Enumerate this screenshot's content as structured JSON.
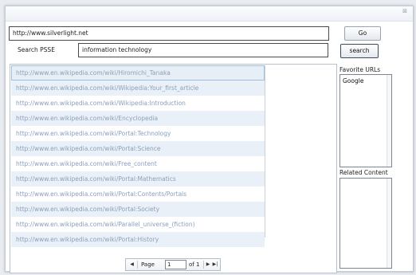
{
  "window": {
    "close_symbol": "⊠"
  },
  "address": {
    "value": "http://www.silverlight.net",
    "go_label": "Go"
  },
  "search": {
    "label": "Search PSSE",
    "value": "information technology",
    "button_label": "search"
  },
  "results": [
    "http://www.en.wikipedia.com/wiki/Hiromichi_Tanaka",
    "http://www.en.wikipedia.com/wiki/Wikipedia:Your_first_article",
    "http://www.en.wikipedia.com/wiki/Wikipedia:Introduction",
    "http://www.en.wikipedia.com/wiki/Encyclopedia",
    "http://www.en.wikipedia.com/wiki/Portal:Technology",
    "http://www.en.wikipedia.com/wiki/Portal:Science",
    "http://www.en.wikipedia.com/wiki/Free_content",
    "http://www.en.wikipedia.com/wiki/Portal:Mathematics",
    "http://www.en.wikipedia.com/wiki/Portal:Contents/Portals",
    "http://www.en.wikipedia.com/wiki/Portal:Society",
    "http://www.en.wikipedia.com/wiki/Parallel_universe_(fiction)",
    "http://www.en.wikipedia.com/wiki/Portal:History"
  ],
  "pager": {
    "page_label": "Page",
    "current_page": "1",
    "of_label": "of 1",
    "first_symbol": "|◀",
    "prev_symbol": "◀",
    "next_symbol": "▶",
    "last_symbol": "▶|"
  },
  "favorites": {
    "label": "Favorite URLs",
    "items": [
      "Google"
    ]
  },
  "related": {
    "label": "Related Content"
  },
  "icons": {
    "close": "close-icon",
    "first": "first-page-icon",
    "prev": "prev-page-icon",
    "next": "next-page-icon",
    "last": "last-page-icon"
  }
}
